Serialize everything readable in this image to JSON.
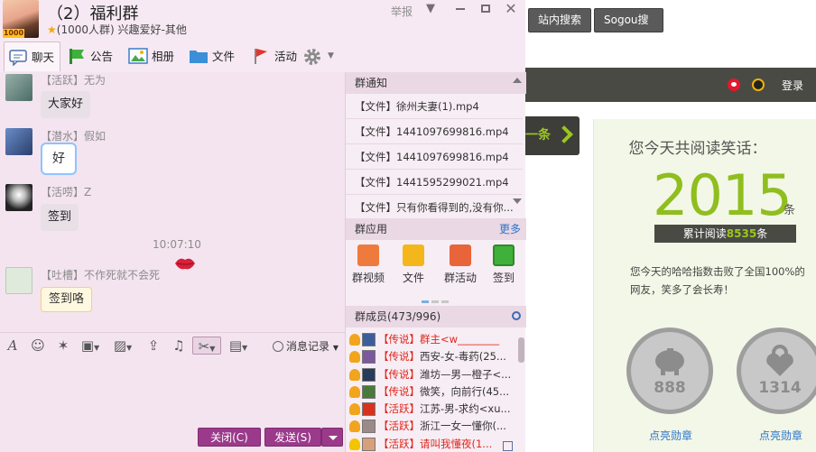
{
  "webpage": {
    "top_buttons": [
      "站内搜索",
      "Sogou搜索"
    ],
    "login": "登录",
    "next_button": "一条",
    "read_title": "您今天共阅读笑话：",
    "read_count": "2015",
    "read_unit": "条",
    "total_read_prefix": "累计阅读",
    "total_read_value": "8535",
    "total_read_suffix": "条",
    "beat_text": "您今天的哈哈指数击败了全国100%的网友，笑多了会长寿！",
    "medals": [
      {
        "number": "888",
        "link": "点亮勋章"
      },
      {
        "number": "1314",
        "link": "点亮勋章"
      }
    ]
  },
  "window": {
    "avatar_badge": "1000",
    "group_name": "（2）福利群",
    "group_meta": "(1000人群) 兴趣爱好-其他",
    "report": "举报",
    "controls": {
      "dropdown": "▼",
      "close": "✕"
    }
  },
  "tabs": [
    {
      "label": "聊天"
    },
    {
      "label": "公告"
    },
    {
      "label": "相册"
    },
    {
      "label": "文件"
    },
    {
      "label": "活动"
    }
  ],
  "chat": {
    "messages": [
      {
        "sender": "【活跃】无为",
        "text": "大家好"
      },
      {
        "sender": "【潜水】假如",
        "text": "好"
      },
      {
        "sender": "【活唠】Z",
        "text": "签到"
      },
      {
        "sender": "【吐槽】不作死就不会死",
        "text": "签到咯"
      }
    ],
    "timestamp": "10:07:10"
  },
  "toolbar": {
    "message_record": "消息记录"
  },
  "buttons": {
    "close": "关闭(C)",
    "send": "发送(S)"
  },
  "sidepanel": {
    "notice_title": "群通知",
    "notices": [
      "【文件】徐州夫妻(1).mp4",
      "【文件】1441097699816.mp4",
      "【文件】1441097699816.mp4",
      "【文件】1441595299021.mp4",
      "【文件】只有你看得到的,没有你..."
    ],
    "apps_title": "群应用",
    "apps_more": "更多",
    "apps": [
      "群视频",
      "文件",
      "群活动",
      "签到"
    ],
    "members_title": "群成员(473/996)",
    "members": [
      {
        "tag": "【传说】",
        "name": "群主<w________"
      },
      {
        "tag": "【传说】",
        "name": "西安-女-毒药(25..."
      },
      {
        "tag": "【传说】",
        "name": "潍坊—男—橙子<..."
      },
      {
        "tag": "【传说】",
        "name": "微笑，向前行(45..."
      },
      {
        "tag": "【活跃】",
        "name": "江苏-男-求约<xu..."
      },
      {
        "tag": "【活跃】",
        "name": "浙江一女一懂你(..."
      },
      {
        "tag": "【活跃】",
        "name": "请叫我懂夜(1..."
      }
    ]
  },
  "colors": {
    "accent": "#9b3a8a",
    "chat_bg": "#f4e4f0",
    "highlight_green": "#8fbe1e"
  }
}
